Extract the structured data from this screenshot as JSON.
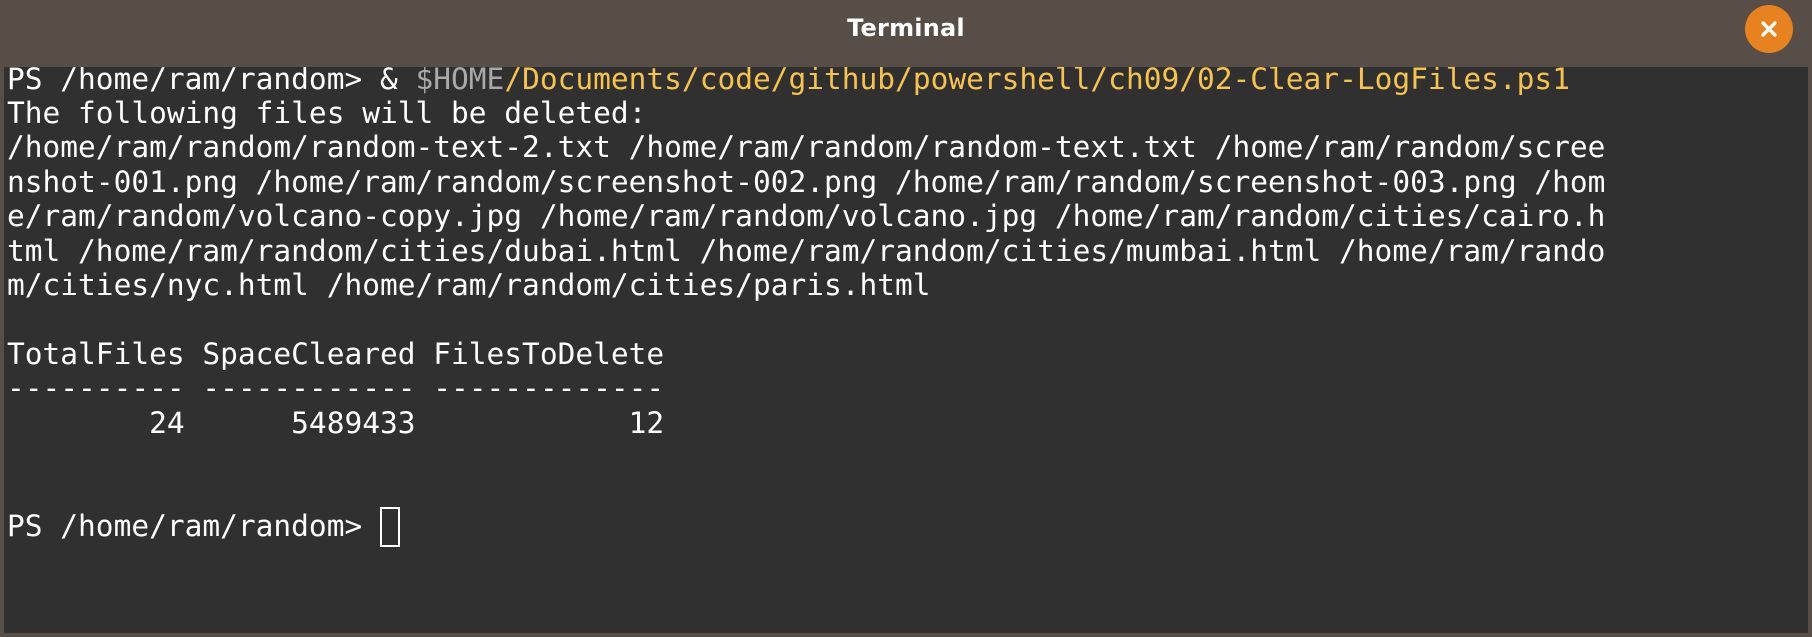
{
  "window": {
    "title": "Terminal",
    "close_icon": "close-icon",
    "accent_color": "#e8821f"
  },
  "terminal": {
    "command": {
      "prompt": "PS /home/ram/random> ",
      "operator": "& ",
      "variable": "$HOME",
      "script_path": "/Documents/code/github/powershell/ch09/02-Clear-LogFiles.ps1"
    },
    "output_header": "The following files will be deleted:",
    "wrapped_file_lines": [
      "/home/ram/random/random-text-2.txt /home/ram/random/random-text.txt /home/ram/random/scree",
      "nshot-001.png /home/ram/random/screenshot-002.png /home/ram/random/screenshot-003.png /hom",
      "e/ram/random/volcano-copy.jpg /home/ram/random/volcano.jpg /home/ram/random/cities/cairo.h",
      "tml /home/ram/random/cities/dubai.html /home/ram/random/cities/mumbai.html /home/ram/rando",
      "m/cities/nyc.html /home/ram/random/cities/paris.html"
    ],
    "table": {
      "header_line": "TotalFiles SpaceCleared FilesToDelete",
      "separator_line": "---------- ------------ -------------",
      "columns": [
        "TotalFiles",
        "SpaceCleared",
        "FilesToDelete"
      ],
      "row": {
        "TotalFiles": "24",
        "SpaceCleared": "5489433",
        "FilesToDelete": "12"
      },
      "row_line": "        24      5489433            12"
    },
    "final_prompt": "PS /home/ram/random> "
  },
  "colors": {
    "terminal_bg": "#303030",
    "titlebar_bg": "#574e48",
    "path_color": "#f7c34a",
    "variable_color": "#a9a9a9",
    "text_color": "#ffffff"
  }
}
